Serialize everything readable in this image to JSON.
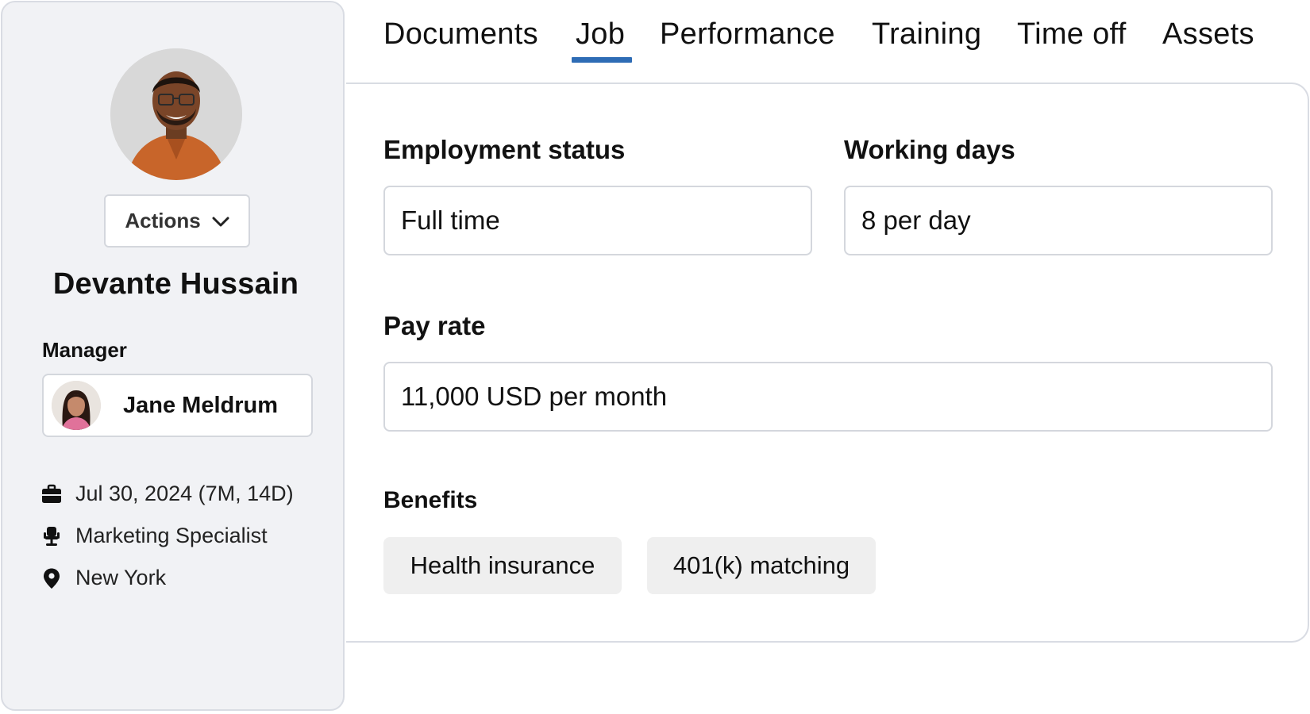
{
  "profile": {
    "name": "Devante Hussain",
    "actions_label": "Actions",
    "manager_label": "Manager",
    "manager_name": "Jane Meldrum",
    "info": {
      "start_date": "Jul 30, 2024 (7M, 14D)",
      "job_title": "Marketing Specialist",
      "location": "New York"
    }
  },
  "tabs": [
    {
      "label": "Documents",
      "active": false
    },
    {
      "label": "Job",
      "active": true
    },
    {
      "label": "Performance",
      "active": false
    },
    {
      "label": "Training",
      "active": false
    },
    {
      "label": "Time off",
      "active": false
    },
    {
      "label": "Assets",
      "active": false
    }
  ],
  "job": {
    "employment_status": {
      "label": "Employment status",
      "value": "Full time"
    },
    "working_days": {
      "label": "Working days",
      "value": "8 per day"
    },
    "pay_rate": {
      "label": "Pay rate",
      "value": "11,000 USD per month"
    },
    "benefits": {
      "label": "Benefits",
      "items": [
        "Health insurance",
        "401(k) matching"
      ]
    }
  },
  "colors": {
    "accent": "#2e6cb5",
    "sidebar_bg": "#f1f2f5",
    "border": "#d9dce3",
    "chip_bg": "#efefef"
  },
  "icons": {
    "start_date": "briefcase-icon",
    "job_title": "office-chair-icon",
    "location": "map-pin-icon",
    "actions": "chevron-down-icon"
  }
}
